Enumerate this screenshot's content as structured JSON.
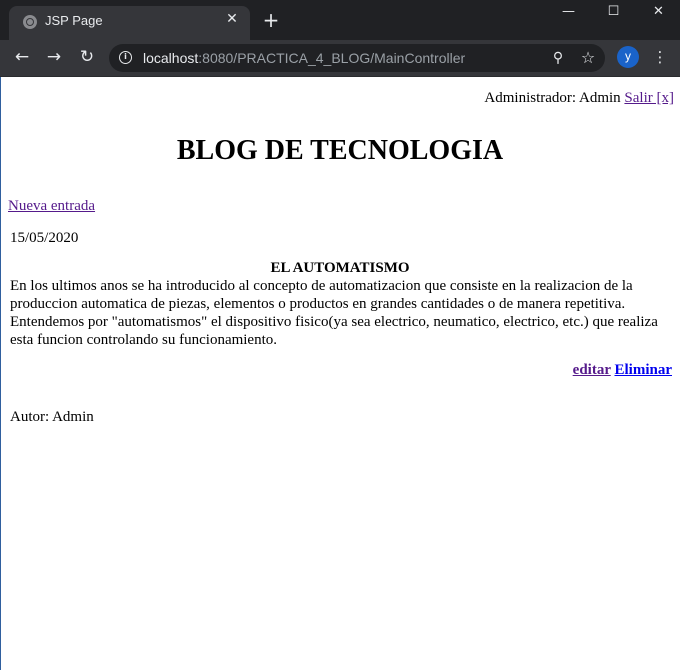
{
  "browser": {
    "tab_title": "JSP Page",
    "tab_close": "✕",
    "new_tab": "+",
    "window_controls": {
      "minimize": "—",
      "maximize": "☐",
      "close": "✕"
    },
    "nav": {
      "back": "←",
      "forward": "→",
      "reload": "↻"
    },
    "url_host": "localhost",
    "url_rest": ":8080/PRACTICA_4_BLOG/MainController",
    "profile_initial": "y",
    "menu": "⋮",
    "colors": {
      "frame": "#202124",
      "toolbar": "#35363a",
      "avatar": "#1a63c9"
    }
  },
  "page": {
    "user_label": "Administrador: Admin",
    "logout_link": "Salir [x]",
    "blog_title": "BLOG DE TECNOLOGIA",
    "new_entry_link": "Nueva entrada",
    "post": {
      "date": "15/05/2020",
      "title": "EL AUTOMATISMO",
      "body": "En los ultimos anos se ha introducido al concepto de automatizacion que consiste en la realizacion de la produccion automatica de piezas, elementos o productos en grandes cantidades o de manera repetitiva. Entendemos por \"automatismos\" el dispositivo fisico(ya sea electrico, neumatico, electrico, etc.) que realiza esta funcion controlando su funcionamiento.",
      "edit_link": "editar",
      "delete_link": "Eliminar",
      "author": "Autor: Admin"
    }
  }
}
